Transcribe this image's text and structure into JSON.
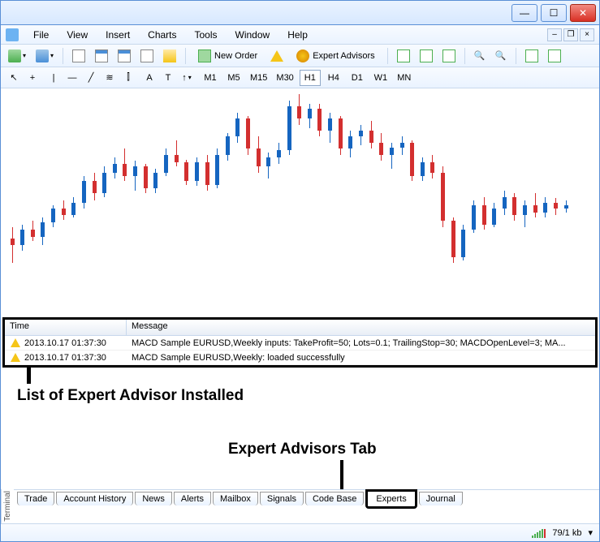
{
  "menu": {
    "file": "File",
    "view": "View",
    "insert": "Insert",
    "charts": "Charts",
    "tools": "Tools",
    "window": "Window",
    "help": "Help"
  },
  "toolbar": {
    "new_order": "New Order",
    "expert_advisors": "Expert Advisors"
  },
  "timeframes": {
    "m1": "M1",
    "m5": "M5",
    "m15": "M15",
    "m30": "M30",
    "h1": "H1",
    "h4": "H4",
    "d1": "D1",
    "w1": "W1",
    "mn": "MN"
  },
  "terminal": {
    "header_time": "Time",
    "header_message": "Message",
    "rows": [
      {
        "time": "2013.10.17 01:37:30",
        "msg": "MACD Sample EURUSD,Weekly inputs: TakeProfit=50; Lots=0.1; TrailingStop=30; MACDOpenLevel=3; MA..."
      },
      {
        "time": "2013.10.17 01:37:30",
        "msg": "MACD Sample EURUSD,Weekly: loaded successfully"
      }
    ]
  },
  "annotations": {
    "list_label": "List of Expert Advisor Installed",
    "tab_label": "Expert Advisors Tab"
  },
  "tabs": {
    "terminal_label": "Terminal",
    "trade": "Trade",
    "account_history": "Account History",
    "news": "News",
    "alerts": "Alerts",
    "mailbox": "Mailbox",
    "signals": "Signals",
    "code_base": "Code Base",
    "experts": "Experts",
    "journal": "Journal"
  },
  "status": {
    "traffic": "79/1 kb"
  },
  "chart_data": {
    "type": "candlestick",
    "note": "Approximate OHLC values estimated from pixel positions; no axis labels visible in screenshot.",
    "candles": [
      {
        "o": 60,
        "h": 70,
        "l": 40,
        "c": 55,
        "dir": "down"
      },
      {
        "o": 55,
        "h": 72,
        "l": 50,
        "c": 68,
        "dir": "up"
      },
      {
        "o": 68,
        "h": 75,
        "l": 58,
        "c": 62,
        "dir": "down"
      },
      {
        "o": 62,
        "h": 78,
        "l": 55,
        "c": 74,
        "dir": "up"
      },
      {
        "o": 74,
        "h": 88,
        "l": 70,
        "c": 85,
        "dir": "up"
      },
      {
        "o": 85,
        "h": 92,
        "l": 76,
        "c": 80,
        "dir": "down"
      },
      {
        "o": 80,
        "h": 95,
        "l": 78,
        "c": 90,
        "dir": "up"
      },
      {
        "o": 90,
        "h": 112,
        "l": 85,
        "c": 108,
        "dir": "up"
      },
      {
        "o": 108,
        "h": 115,
        "l": 92,
        "c": 98,
        "dir": "down"
      },
      {
        "o": 98,
        "h": 120,
        "l": 95,
        "c": 115,
        "dir": "up"
      },
      {
        "o": 115,
        "h": 128,
        "l": 110,
        "c": 122,
        "dir": "up"
      },
      {
        "o": 122,
        "h": 135,
        "l": 108,
        "c": 112,
        "dir": "down"
      },
      {
        "o": 112,
        "h": 125,
        "l": 100,
        "c": 120,
        "dir": "up"
      },
      {
        "o": 120,
        "h": 122,
        "l": 98,
        "c": 102,
        "dir": "down"
      },
      {
        "o": 102,
        "h": 118,
        "l": 98,
        "c": 115,
        "dir": "up"
      },
      {
        "o": 115,
        "h": 135,
        "l": 112,
        "c": 130,
        "dir": "up"
      },
      {
        "o": 130,
        "h": 142,
        "l": 120,
        "c": 124,
        "dir": "down"
      },
      {
        "o": 124,
        "h": 126,
        "l": 105,
        "c": 108,
        "dir": "down"
      },
      {
        "o": 108,
        "h": 128,
        "l": 104,
        "c": 124,
        "dir": "up"
      },
      {
        "o": 124,
        "h": 130,
        "l": 100,
        "c": 105,
        "dir": "down"
      },
      {
        "o": 105,
        "h": 135,
        "l": 102,
        "c": 130,
        "dir": "up"
      },
      {
        "o": 130,
        "h": 148,
        "l": 125,
        "c": 145,
        "dir": "up"
      },
      {
        "o": 145,
        "h": 165,
        "l": 140,
        "c": 160,
        "dir": "up"
      },
      {
        "o": 160,
        "h": 162,
        "l": 130,
        "c": 135,
        "dir": "down"
      },
      {
        "o": 135,
        "h": 145,
        "l": 115,
        "c": 120,
        "dir": "down"
      },
      {
        "o": 120,
        "h": 132,
        "l": 110,
        "c": 128,
        "dir": "up"
      },
      {
        "o": 128,
        "h": 140,
        "l": 122,
        "c": 134,
        "dir": "up"
      },
      {
        "o": 134,
        "h": 175,
        "l": 130,
        "c": 170,
        "dir": "up"
      },
      {
        "o": 170,
        "h": 180,
        "l": 155,
        "c": 160,
        "dir": "down"
      },
      {
        "o": 160,
        "h": 172,
        "l": 152,
        "c": 168,
        "dir": "up"
      },
      {
        "o": 168,
        "h": 172,
        "l": 145,
        "c": 150,
        "dir": "down"
      },
      {
        "o": 150,
        "h": 165,
        "l": 140,
        "c": 160,
        "dir": "up"
      },
      {
        "o": 160,
        "h": 162,
        "l": 130,
        "c": 135,
        "dir": "down"
      },
      {
        "o": 135,
        "h": 150,
        "l": 128,
        "c": 145,
        "dir": "up"
      },
      {
        "o": 145,
        "h": 155,
        "l": 138,
        "c": 150,
        "dir": "up"
      },
      {
        "o": 150,
        "h": 158,
        "l": 135,
        "c": 140,
        "dir": "down"
      },
      {
        "o": 140,
        "h": 148,
        "l": 125,
        "c": 130,
        "dir": "down"
      },
      {
        "o": 130,
        "h": 140,
        "l": 118,
        "c": 136,
        "dir": "up"
      },
      {
        "o": 136,
        "h": 145,
        "l": 130,
        "c": 140,
        "dir": "up"
      },
      {
        "o": 140,
        "h": 142,
        "l": 108,
        "c": 112,
        "dir": "down"
      },
      {
        "o": 112,
        "h": 128,
        "l": 108,
        "c": 124,
        "dir": "up"
      },
      {
        "o": 124,
        "h": 130,
        "l": 110,
        "c": 115,
        "dir": "down"
      },
      {
        "o": 115,
        "h": 120,
        "l": 70,
        "c": 75,
        "dir": "down"
      },
      {
        "o": 75,
        "h": 78,
        "l": 40,
        "c": 45,
        "dir": "down"
      },
      {
        "o": 45,
        "h": 72,
        "l": 42,
        "c": 68,
        "dir": "up"
      },
      {
        "o": 68,
        "h": 92,
        "l": 65,
        "c": 88,
        "dir": "up"
      },
      {
        "o": 88,
        "h": 95,
        "l": 68,
        "c": 72,
        "dir": "down"
      },
      {
        "o": 72,
        "h": 90,
        "l": 70,
        "c": 85,
        "dir": "up"
      },
      {
        "o": 85,
        "h": 100,
        "l": 80,
        "c": 95,
        "dir": "up"
      },
      {
        "o": 95,
        "h": 98,
        "l": 75,
        "c": 80,
        "dir": "down"
      },
      {
        "o": 80,
        "h": 92,
        "l": 70,
        "c": 88,
        "dir": "up"
      },
      {
        "o": 88,
        "h": 98,
        "l": 78,
        "c": 82,
        "dir": "down"
      },
      {
        "o": 82,
        "h": 95,
        "l": 78,
        "c": 90,
        "dir": "up"
      },
      {
        "o": 90,
        "h": 94,
        "l": 80,
        "c": 85,
        "dir": "down"
      },
      {
        "o": 85,
        "h": 92,
        "l": 82,
        "c": 88,
        "dir": "up"
      }
    ]
  }
}
